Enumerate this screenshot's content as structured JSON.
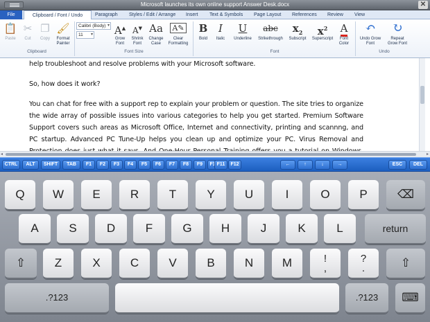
{
  "window": {
    "title": "Microsoft launches its own online support Answer Desk.docx",
    "close_glyph": "✕"
  },
  "ribbon_tabs": [
    "File",
    "Clipboard / Font / Undo",
    "Paragraph",
    "Styles / Edit / Arrange",
    "Insert",
    "Text & Symbols",
    "Page Layout",
    "References",
    "Review",
    "View"
  ],
  "active_tab": "Clipboard / Font / Undo",
  "clipboard": {
    "paste": "Paste",
    "cut": "Cut",
    "copy": "Copy",
    "format_painter": "Format\nPainter",
    "group": "Clipboard"
  },
  "font_size_group": {
    "font_name": "Calibri (Body)",
    "font_size": "11",
    "grow": "Grow\nFont",
    "shrink": "Shrink\nFont",
    "change_case": "Change\nCase",
    "clear": "Clear\nFormatting",
    "group": "Font Size"
  },
  "font_group": {
    "bold": "Bold",
    "italic": "Italic",
    "underline": "Underline",
    "strikethrough": "Strikethrough",
    "subscript": "Subscript",
    "superscript": "Superscript",
    "font_color": "Font\nColor",
    "group": "Font"
  },
  "undo_group": {
    "undo": "Undo Grow\nFont",
    "repeat": "Repeat\nGrow Font",
    "group": "Undo"
  },
  "document": {
    "paragraphs": [
      "help troubleshoot and resolve problems with your Microsoft software.",
      "So, how does it work?",
      "You can chat for free with a support rep to explain your problem or question. The site tries to organize the wide array of possible issues into various categories to help you get started. Premium Software Support covers such areas as Microsoft Office, Internet and connectivity, printing and scannng, and PC startup. Advanced PC Tune-Up helps you clean up and optimize your PC. Virus Removal and Protection does just what it says. And One-Hour Personal Training offers you a tutorial on Windows, Office, and"
    ]
  },
  "function_keys": [
    "CTRL",
    "ALT",
    "SHIFT",
    "TAB",
    "F1",
    "F2",
    "F3",
    "F4",
    "F5",
    "F6",
    "F7",
    "F8",
    "F9",
    "F10",
    "F11",
    "F12"
  ],
  "arrow_keys": [
    "←",
    "↑",
    "↓",
    "→"
  ],
  "right_keys": [
    "ESC",
    "DEL"
  ],
  "keyboard": {
    "row1": [
      "Q",
      "W",
      "E",
      "R",
      "T",
      "Y",
      "U",
      "I",
      "O",
      "P"
    ],
    "backspace": "⌫",
    "row2": [
      "A",
      "S",
      "D",
      "F",
      "G",
      "H",
      "J",
      "K",
      "L"
    ],
    "return": "return",
    "shift": "⇧",
    "row3": [
      "Z",
      "X",
      "C",
      "V",
      "B",
      "N",
      "M"
    ],
    "punct1": [
      "!",
      ","
    ],
    "punct2": [
      "?",
      "."
    ],
    "numbers": ".?123",
    "hide": "⌨"
  },
  "colors": {
    "accent": "#2a62c0",
    "font_color_bar": "#d9241c"
  }
}
